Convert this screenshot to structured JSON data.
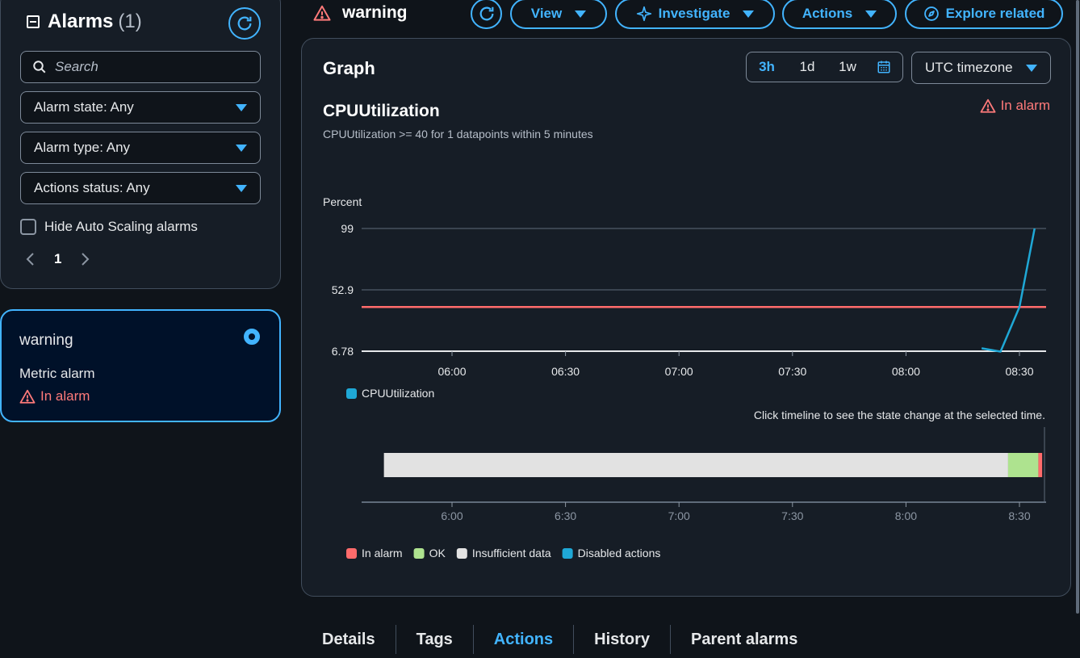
{
  "sidebar": {
    "title": "Alarms",
    "count": "(1)",
    "search_placeholder": "Search",
    "filters": [
      {
        "label": "Alarm state: Any"
      },
      {
        "label": "Alarm type: Any"
      },
      {
        "label": "Actions status: Any"
      }
    ],
    "hide_autoscaling_label": "Hide Auto Scaling alarms",
    "page": "1",
    "alarm": {
      "name": "warning",
      "type": "Metric alarm",
      "state": "In alarm"
    }
  },
  "header": {
    "alarm_name": "warning",
    "buttons": {
      "view": "View",
      "investigate": "Investigate",
      "actions": "Actions",
      "explore": "Explore related"
    }
  },
  "graph": {
    "title": "Graph",
    "ranges": [
      "3h",
      "1d",
      "1w"
    ],
    "timezone": "UTC timezone",
    "metric_title": "CPUUtilization",
    "description": "CPUUtilization >= 40 for 1 datapoints within 5 minutes",
    "state": "In alarm",
    "hint": "Click timeline to see the state change at the selected time."
  },
  "chart_data": {
    "type": "line",
    "ylabel": "Percent",
    "y_ticks": [
      "99",
      "52.9",
      "6.78"
    ],
    "ylim": [
      6.78,
      99
    ],
    "x_ticks": [
      "06:00",
      "06:30",
      "07:00",
      "07:30",
      "08:00",
      "08:30"
    ],
    "series": [
      {
        "name": "CPUUtilization",
        "color": "#1fa8d6",
        "x": [
          "08:20",
          "08:25",
          "08:30",
          "08:34"
        ],
        "values": [
          9,
          6.5,
          40,
          99
        ]
      }
    ],
    "threshold": {
      "value": 40,
      "color": "#ff6b6b"
    },
    "timeline": {
      "ticks": [
        "6:00",
        "6:30",
        "7:00",
        "7:30",
        "8:00",
        "8:30"
      ],
      "segments": [
        {
          "state": "Insufficient data",
          "from": "05:42",
          "to": "08:27",
          "color": "#e2e2e2"
        },
        {
          "state": "OK",
          "from": "08:27",
          "to": "08:35",
          "color": "#aee38f"
        },
        {
          "state": "In alarm",
          "from": "08:35",
          "to": "08:36",
          "color": "#ff6b6b"
        }
      ],
      "legend": [
        {
          "label": "In alarm",
          "color": "#ff6b6b"
        },
        {
          "label": "OK",
          "color": "#aee38f"
        },
        {
          "label": "Insufficient data",
          "color": "#e2e2e2"
        },
        {
          "label": "Disabled actions",
          "color": "#1fa8d6"
        }
      ]
    }
  },
  "tabs": [
    "Details",
    "Tags",
    "Actions",
    "History",
    "Parent alarms"
  ],
  "active_tab": "Actions"
}
